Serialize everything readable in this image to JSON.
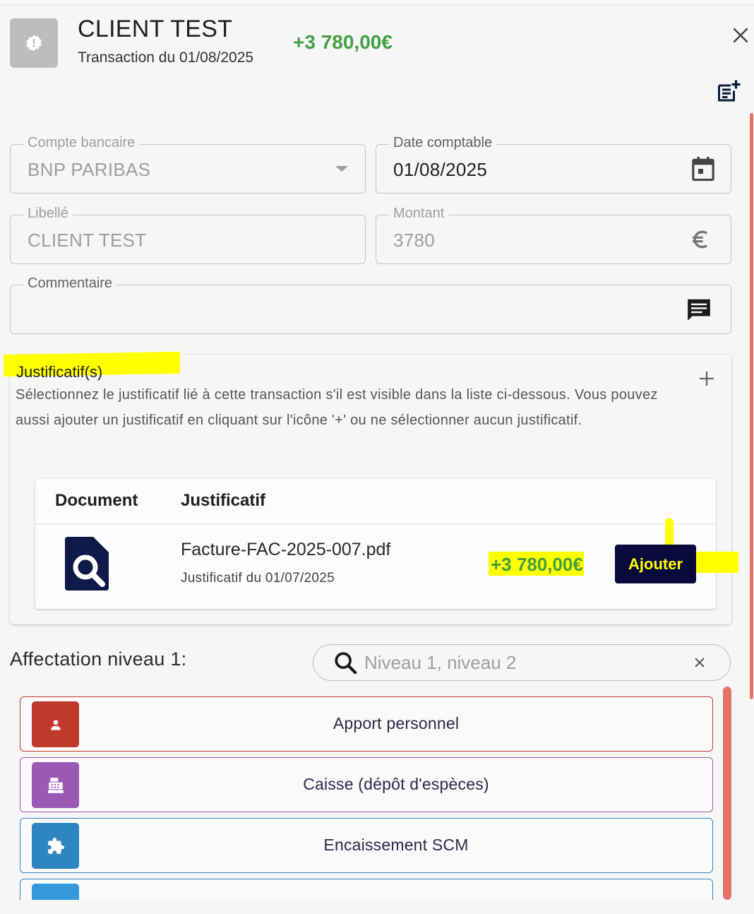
{
  "header": {
    "title": "CLIENT TEST",
    "subtitle": "Transaction du 01/08/2025",
    "amount": "+3 780,00€",
    "avatar_icon": "alert-badge-icon",
    "close_icon": "close-icon",
    "add_note_icon": "note-add-icon"
  },
  "form": {
    "bank_account": {
      "label": "Compte bancaire",
      "value": "BNP PARIBAS",
      "icon": "dropdown-arrow-icon"
    },
    "accounting_date": {
      "label": "Date comptable",
      "value": "01/08/2025",
      "icon": "calendar-icon"
    },
    "label": {
      "label": "Libellé",
      "value": "CLIENT TEST"
    },
    "amount": {
      "label": "Montant",
      "value": "3780",
      "icon": "euro-icon"
    },
    "comment": {
      "label": "Commentaire",
      "value": "",
      "icon": "comment-icon"
    }
  },
  "justificatifs": {
    "title": "Justificatif(s)",
    "description": "Sélectionnez le justificatif lié à cette transaction s'il est visible dans la liste ci-dessous. Vous pouvez aussi ajouter un justificatif en cliquant sur l'icône '+' ou ne sélectionner aucun justificatif.",
    "add_icon": "plus-icon",
    "columns": [
      "Document",
      "Justificatif"
    ],
    "rows": [
      {
        "file_name": "Facture-FAC-2025-007.pdf",
        "subtitle": "Justificatif du 01/07/2025",
        "amount": "+3 780,00€",
        "action_label": "Ajouter",
        "icon": "document-search-icon"
      }
    ]
  },
  "affectation": {
    "label": "Affectation niveau 1:",
    "search_placeholder": "Niveau 1, niveau 2",
    "categories": [
      {
        "label": "Apport personnel",
        "color": "#c0392b",
        "icon": "person-icon"
      },
      {
        "label": "Caisse (dépôt d'espèces)",
        "color": "#9b59b6",
        "icon": "cash-register-icon"
      },
      {
        "label": "Encaissement SCM",
        "color": "#2e86c1",
        "icon": "puzzle-icon"
      }
    ]
  },
  "colors": {
    "accent_green": "#43a047",
    "button_dark": "#0a0a3c",
    "highlight": "#ffff00",
    "scrollbar": "#e57368"
  }
}
